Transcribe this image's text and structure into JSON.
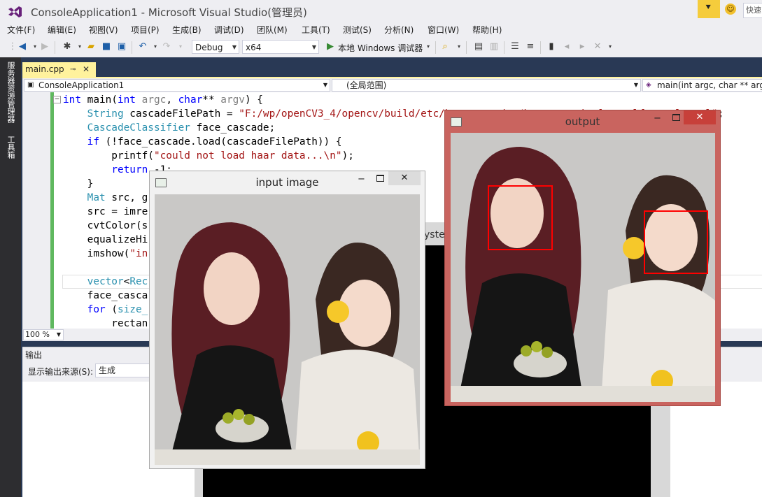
{
  "window": {
    "title": "ConsoleApplication1 - Microsoft Visual Studio(管理员)",
    "quick_launch": "快速"
  },
  "menu": [
    "文件(F)",
    "编辑(E)",
    "视图(V)",
    "项目(P)",
    "生成(B)",
    "调试(D)",
    "团队(M)",
    "工具(T)",
    "测试(S)",
    "分析(N)",
    "窗口(W)",
    "帮助(H)"
  ],
  "toolbar": {
    "config": "Debug",
    "platform": "x64",
    "run_label": "本地 Windows 调试器"
  },
  "side_tabs": [
    "服务器资源管理器",
    "工具箱"
  ],
  "editor": {
    "tab_label": "main.cpp",
    "nav_project": "ConsoleApplication1",
    "nav_scope": "(全局范围)",
    "nav_member": "main(int argc, char ** argv)",
    "zoom": "100 %",
    "code": {
      "l1_a": "int",
      "l1_b": " main(",
      "l1_c": "int",
      "l1_d": " ",
      "l1_e": "argc",
      "l1_f": ", ",
      "l1_g": "char",
      "l1_h": "** ",
      "l1_i": "argv",
      "l1_j": ") {",
      "l2_a": "    ",
      "l2_b": "String",
      "l2_c": " cascadeFilePath = ",
      "l2_d": "\"F:/wp/openCV3_4/opencv/build/etc/haarcascades/haarcascade_frontalface_alt.xml\"",
      "l2_e": ";",
      "l3_a": "    ",
      "l3_b": "CascadeClassifier",
      "l3_c": " face_cascade;",
      "l4_a": "    ",
      "l4_b": "if",
      "l4_c": " (!face_cascade.load(cascadeFilePath)) {",
      "l5_a": "        printf(",
      "l5_b": "\"could not load haar data...\\n\"",
      "l5_c": ");",
      "l6_a": "        ",
      "l6_b": "return",
      "l6_c": " -1;",
      "l7": "    }",
      "l8_a": "    ",
      "l8_b": "Mat",
      "l8_c": " src, g",
      "l9": "    src = imre",
      "l10": "    cvtColor(s",
      "l11": "    equalizeHi",
      "l12_a": "    imshow(",
      "l12_b": "\"in",
      "l13": "",
      "l14_a": "    ",
      "l14_b": "vector",
      "l14_c": "<",
      "l14_d": "Rec",
      "l15": "    face_casca",
      "l16_a": "    ",
      "l16_b": "for",
      "l16_c": " (",
      "l16_d": "size_",
      "l17": "        rectan"
    }
  },
  "output_pane": {
    "title": "输出",
    "source_label": "显示输出来源(S):",
    "source_value": "生成"
  },
  "console": {
    "title_fragment": "yste"
  },
  "input_window": {
    "title": "input image"
  },
  "output_window": {
    "title": "output"
  },
  "detections": {
    "count": 2
  },
  "colors": {
    "accent": "#fff29d",
    "dock": "#293955",
    "detect_box": "#ff0000",
    "output_frame": "#c9645f"
  }
}
